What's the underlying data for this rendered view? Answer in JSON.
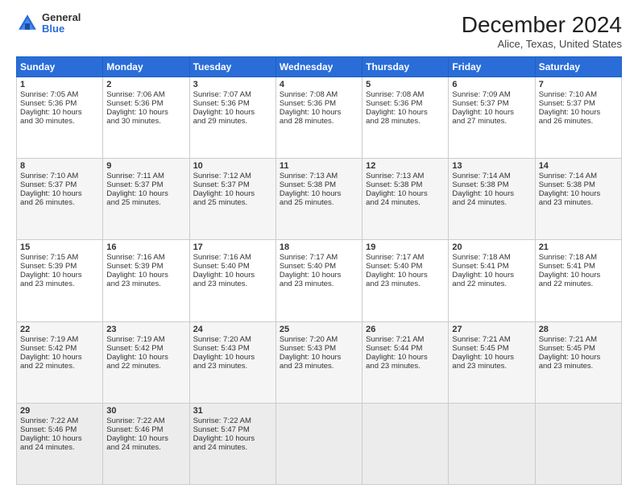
{
  "logo": {
    "general": "General",
    "blue": "Blue"
  },
  "header": {
    "month": "December 2024",
    "location": "Alice, Texas, United States"
  },
  "columns": [
    "Sunday",
    "Monday",
    "Tuesday",
    "Wednesday",
    "Thursday",
    "Friday",
    "Saturday"
  ],
  "weeks": [
    [
      {
        "day": "1",
        "lines": [
          "Sunrise: 7:05 AM",
          "Sunset: 5:36 PM",
          "Daylight: 10 hours",
          "and 30 minutes."
        ]
      },
      {
        "day": "2",
        "lines": [
          "Sunrise: 7:06 AM",
          "Sunset: 5:36 PM",
          "Daylight: 10 hours",
          "and 30 minutes."
        ]
      },
      {
        "day": "3",
        "lines": [
          "Sunrise: 7:07 AM",
          "Sunset: 5:36 PM",
          "Daylight: 10 hours",
          "and 29 minutes."
        ]
      },
      {
        "day": "4",
        "lines": [
          "Sunrise: 7:08 AM",
          "Sunset: 5:36 PM",
          "Daylight: 10 hours",
          "and 28 minutes."
        ]
      },
      {
        "day": "5",
        "lines": [
          "Sunrise: 7:08 AM",
          "Sunset: 5:36 PM",
          "Daylight: 10 hours",
          "and 28 minutes."
        ]
      },
      {
        "day": "6",
        "lines": [
          "Sunrise: 7:09 AM",
          "Sunset: 5:37 PM",
          "Daylight: 10 hours",
          "and 27 minutes."
        ]
      },
      {
        "day": "7",
        "lines": [
          "Sunrise: 7:10 AM",
          "Sunset: 5:37 PM",
          "Daylight: 10 hours",
          "and 26 minutes."
        ]
      }
    ],
    [
      {
        "day": "8",
        "lines": [
          "Sunrise: 7:10 AM",
          "Sunset: 5:37 PM",
          "Daylight: 10 hours",
          "and 26 minutes."
        ]
      },
      {
        "day": "9",
        "lines": [
          "Sunrise: 7:11 AM",
          "Sunset: 5:37 PM",
          "Daylight: 10 hours",
          "and 25 minutes."
        ]
      },
      {
        "day": "10",
        "lines": [
          "Sunrise: 7:12 AM",
          "Sunset: 5:37 PM",
          "Daylight: 10 hours",
          "and 25 minutes."
        ]
      },
      {
        "day": "11",
        "lines": [
          "Sunrise: 7:13 AM",
          "Sunset: 5:38 PM",
          "Daylight: 10 hours",
          "and 25 minutes."
        ]
      },
      {
        "day": "12",
        "lines": [
          "Sunrise: 7:13 AM",
          "Sunset: 5:38 PM",
          "Daylight: 10 hours",
          "and 24 minutes."
        ]
      },
      {
        "day": "13",
        "lines": [
          "Sunrise: 7:14 AM",
          "Sunset: 5:38 PM",
          "Daylight: 10 hours",
          "and 24 minutes."
        ]
      },
      {
        "day": "14",
        "lines": [
          "Sunrise: 7:14 AM",
          "Sunset: 5:38 PM",
          "Daylight: 10 hours",
          "and 23 minutes."
        ]
      }
    ],
    [
      {
        "day": "15",
        "lines": [
          "Sunrise: 7:15 AM",
          "Sunset: 5:39 PM",
          "Daylight: 10 hours",
          "and 23 minutes."
        ]
      },
      {
        "day": "16",
        "lines": [
          "Sunrise: 7:16 AM",
          "Sunset: 5:39 PM",
          "Daylight: 10 hours",
          "and 23 minutes."
        ]
      },
      {
        "day": "17",
        "lines": [
          "Sunrise: 7:16 AM",
          "Sunset: 5:40 PM",
          "Daylight: 10 hours",
          "and 23 minutes."
        ]
      },
      {
        "day": "18",
        "lines": [
          "Sunrise: 7:17 AM",
          "Sunset: 5:40 PM",
          "Daylight: 10 hours",
          "and 23 minutes."
        ]
      },
      {
        "day": "19",
        "lines": [
          "Sunrise: 7:17 AM",
          "Sunset: 5:40 PM",
          "Daylight: 10 hours",
          "and 23 minutes."
        ]
      },
      {
        "day": "20",
        "lines": [
          "Sunrise: 7:18 AM",
          "Sunset: 5:41 PM",
          "Daylight: 10 hours",
          "and 22 minutes."
        ]
      },
      {
        "day": "21",
        "lines": [
          "Sunrise: 7:18 AM",
          "Sunset: 5:41 PM",
          "Daylight: 10 hours",
          "and 22 minutes."
        ]
      }
    ],
    [
      {
        "day": "22",
        "lines": [
          "Sunrise: 7:19 AM",
          "Sunset: 5:42 PM",
          "Daylight: 10 hours",
          "and 22 minutes."
        ]
      },
      {
        "day": "23",
        "lines": [
          "Sunrise: 7:19 AM",
          "Sunset: 5:42 PM",
          "Daylight: 10 hours",
          "and 22 minutes."
        ]
      },
      {
        "day": "24",
        "lines": [
          "Sunrise: 7:20 AM",
          "Sunset: 5:43 PM",
          "Daylight: 10 hours",
          "and 23 minutes."
        ]
      },
      {
        "day": "25",
        "lines": [
          "Sunrise: 7:20 AM",
          "Sunset: 5:43 PM",
          "Daylight: 10 hours",
          "and 23 minutes."
        ]
      },
      {
        "day": "26",
        "lines": [
          "Sunrise: 7:21 AM",
          "Sunset: 5:44 PM",
          "Daylight: 10 hours",
          "and 23 minutes."
        ]
      },
      {
        "day": "27",
        "lines": [
          "Sunrise: 7:21 AM",
          "Sunset: 5:45 PM",
          "Daylight: 10 hours",
          "and 23 minutes."
        ]
      },
      {
        "day": "28",
        "lines": [
          "Sunrise: 7:21 AM",
          "Sunset: 5:45 PM",
          "Daylight: 10 hours",
          "and 23 minutes."
        ]
      }
    ],
    [
      {
        "day": "29",
        "lines": [
          "Sunrise: 7:22 AM",
          "Sunset: 5:46 PM",
          "Daylight: 10 hours",
          "and 24 minutes."
        ]
      },
      {
        "day": "30",
        "lines": [
          "Sunrise: 7:22 AM",
          "Sunset: 5:46 PM",
          "Daylight: 10 hours",
          "and 24 minutes."
        ]
      },
      {
        "day": "31",
        "lines": [
          "Sunrise: 7:22 AM",
          "Sunset: 5:47 PM",
          "Daylight: 10 hours",
          "and 24 minutes."
        ]
      },
      null,
      null,
      null,
      null
    ]
  ]
}
